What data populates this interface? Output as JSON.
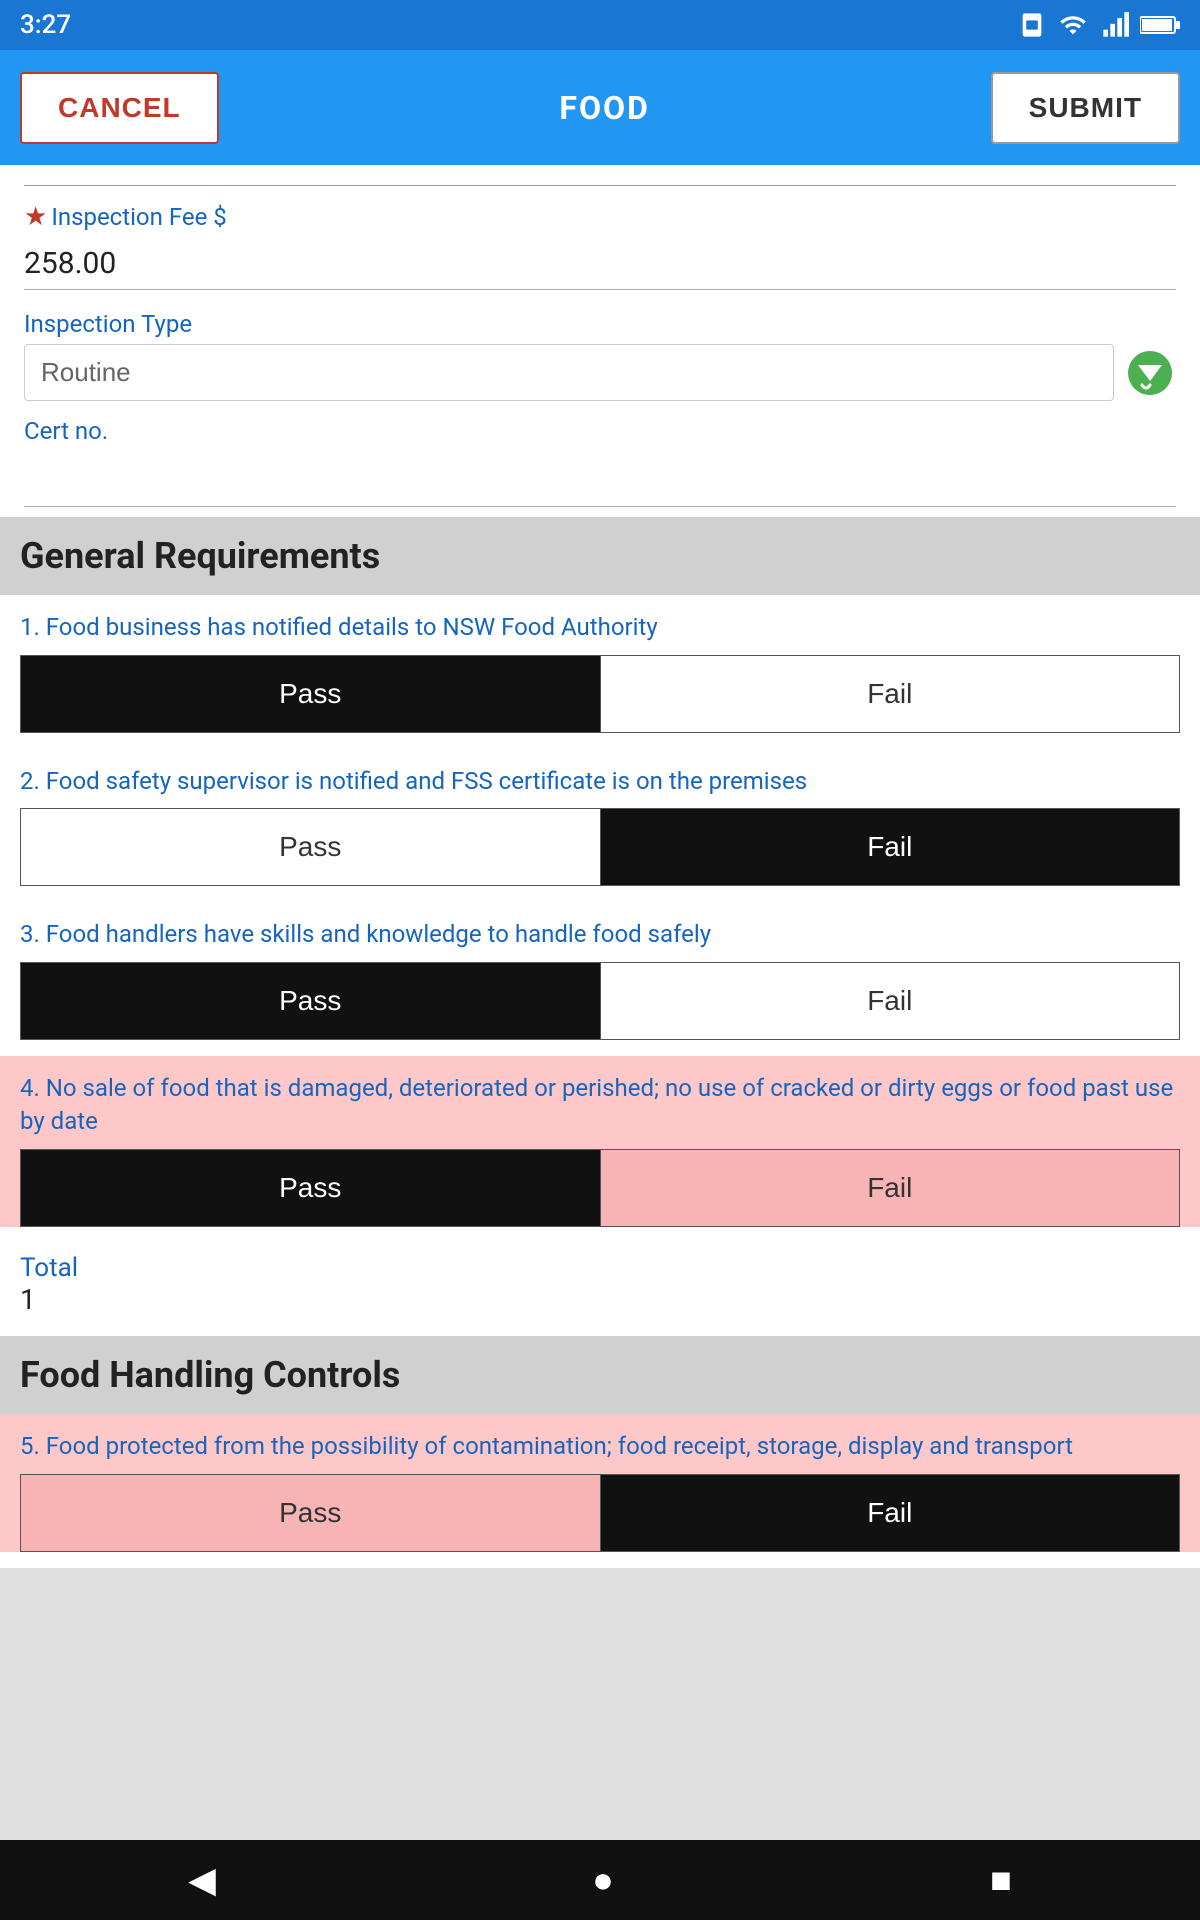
{
  "status_bar": {
    "time": "3:27",
    "icons": [
      "sim-card-icon",
      "wifi-icon",
      "signal-icon",
      "battery-icon"
    ]
  },
  "top_bar": {
    "cancel_label": "CANCEL",
    "title": "FOOD",
    "submit_label": "SUBMIT"
  },
  "form": {
    "inspection_fee_label": "Inspection Fee $",
    "inspection_fee_value": "258.00",
    "inspection_type_label": "Inspection Type",
    "inspection_type_placeholder": "Routine",
    "cert_label": "Cert no.",
    "cert_value": ""
  },
  "general_requirements": {
    "section_title": "General Requirements",
    "items": [
      {
        "id": 1,
        "text": "1. Food business has notified details to NSW Food Authority",
        "pass_state": "active",
        "fail_state": "inactive",
        "highlighted": false
      },
      {
        "id": 2,
        "text": "2. Food safety supervisor is notified and FSS certificate is on the premises",
        "pass_state": "inactive",
        "fail_state": "active",
        "highlighted": false
      },
      {
        "id": 3,
        "text": "3. Food handlers have skills and knowledge to handle food safely",
        "pass_state": "active",
        "fail_state": "inactive",
        "highlighted": false
      },
      {
        "id": 4,
        "text": "4. No sale of food that is damaged, deteriorated or perished; no use of cracked or dirty eggs or food past use by date",
        "pass_state": "active",
        "fail_state": "active-fail-highlight",
        "highlighted": true
      }
    ],
    "total_label": "Total",
    "total_value": "1"
  },
  "food_handling_controls": {
    "section_title": "Food Handling Controls",
    "items": [
      {
        "id": 5,
        "text": "5. Food protected from the possibility of contamination; food receipt, storage, display and transport",
        "pass_state": "active-fail-highlight",
        "fail_state": "active",
        "highlighted": true
      }
    ]
  },
  "nav_bar": {
    "back_label": "◀",
    "home_label": "●",
    "recent_label": "■"
  }
}
